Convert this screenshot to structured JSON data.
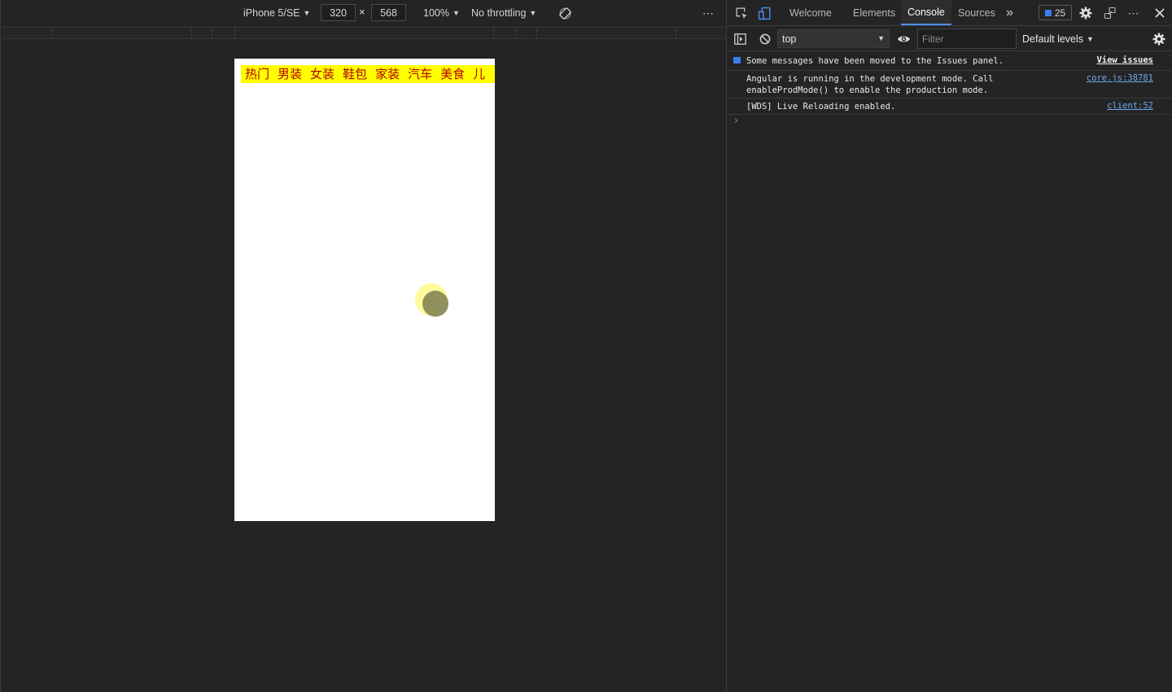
{
  "emulation": {
    "device": "iPhone 5/SE",
    "width": "320",
    "height": "568",
    "times_symbol": "×",
    "zoom": "100%",
    "throttling": "No throttling",
    "more": "⋯"
  },
  "page": {
    "nav_items": [
      "热门",
      "男装",
      "女装",
      "鞋包",
      "家装",
      "汽车",
      "美食",
      "儿"
    ],
    "nav_bg_color": "#ffff00",
    "nav_text_color": "#b50000"
  },
  "devtools": {
    "tabs": {
      "welcome": "Welcome",
      "elements": "Elements",
      "console": "Console",
      "sources": "Sources",
      "more": "»"
    },
    "issues_count": "25",
    "context": "top",
    "filter_placeholder": "Filter",
    "levels": "Default levels",
    "accent_color": "#4c8ff5"
  },
  "console": {
    "issues_msg": "Some messages have been moved to the Issues panel.",
    "issues_link": "View issues",
    "angular_msg": "Angular is running in the development mode. Call\nenableProdMode() to enable the production mode.",
    "angular_src": "core.js:38781",
    "wds_msg": "[WDS] Live Reloading enabled.",
    "wds_src": "client:52",
    "prompt": "›"
  }
}
